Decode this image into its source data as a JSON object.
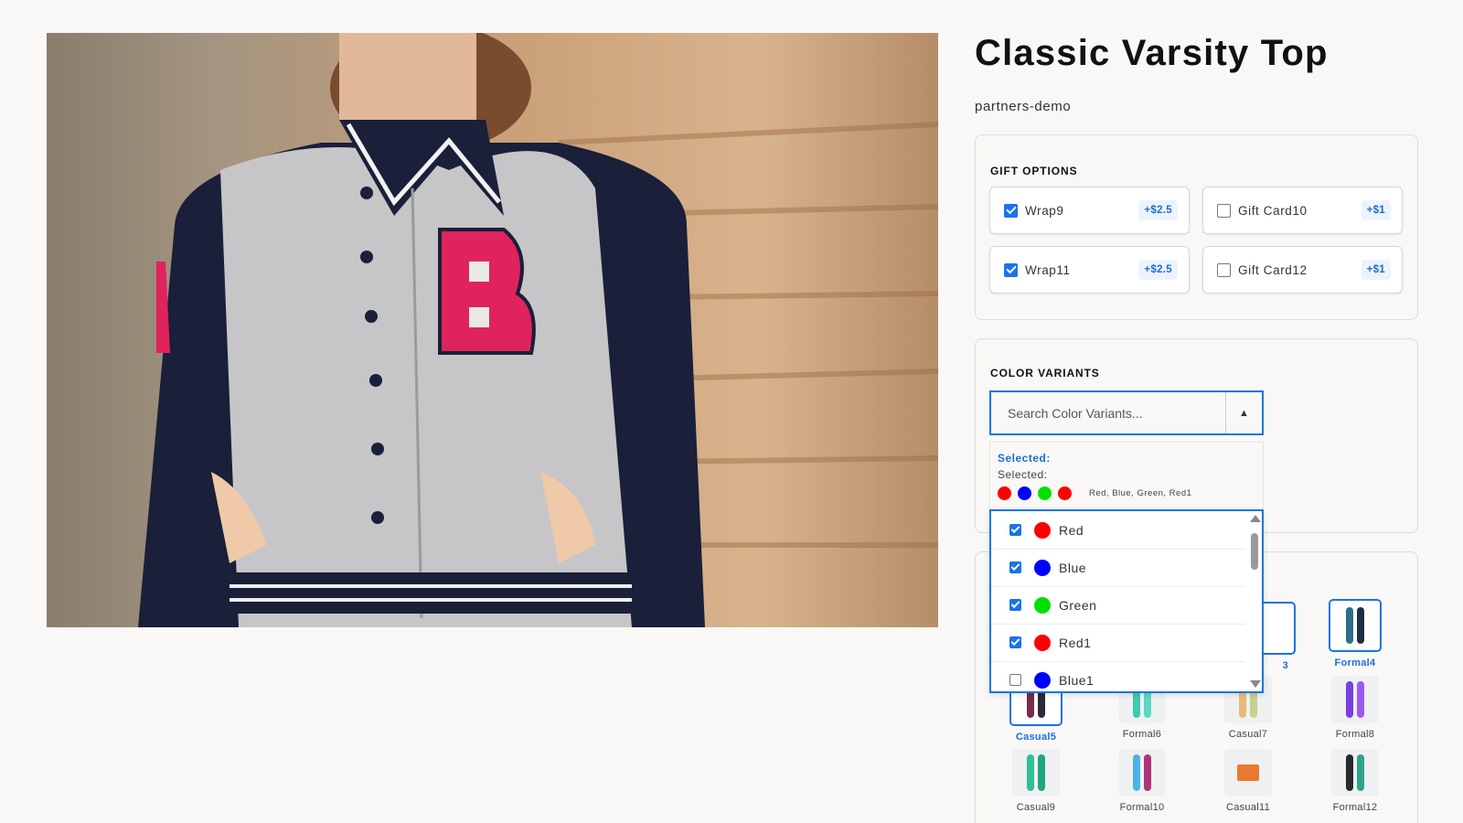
{
  "product": {
    "title": "Classic Varsity Top",
    "vendor": "partners-demo",
    "image_alt": "Woman wearing a grey and navy varsity jacket with a pink B patch"
  },
  "gift_options": {
    "heading": "GIFT OPTIONS",
    "options": [
      {
        "label": "Wrap9",
        "price": "+$2.5",
        "checked": true
      },
      {
        "label": "Gift Card10",
        "price": "+$1",
        "checked": false
      },
      {
        "label": "Wrap11",
        "price": "+$2.5",
        "checked": true
      },
      {
        "label": "Gift Card12",
        "price": "+$1",
        "checked": false
      }
    ]
  },
  "color_variants": {
    "heading": "COLOR VARIANTS",
    "search_placeholder": "Search Color Variants...",
    "toggle_icon": "▲",
    "selected_heading": "Selected:",
    "selected_sub": "Selected:",
    "selected_colors": [
      "#ff0000",
      "#0000ff",
      "#00e000",
      "#ff0000"
    ],
    "selected_names": "Red, Blue, Green, Red1",
    "options": [
      {
        "name": "Red",
        "color": "#ff0000",
        "checked": true
      },
      {
        "name": "Blue",
        "color": "#0000ff",
        "checked": true
      },
      {
        "name": "Green",
        "color": "#00e000",
        "checked": true
      },
      {
        "name": "Red1",
        "color": "#ff0000",
        "checked": true
      },
      {
        "name": "Blue1",
        "color": "#0000ff",
        "checked": false
      }
    ]
  },
  "styles": {
    "items": [
      {
        "label": "3",
        "selected": true
      },
      {
        "label": "Formal4",
        "selected": true
      },
      {
        "label": "Casual5",
        "selected": true
      },
      {
        "label": "Formal6",
        "selected": false
      },
      {
        "label": "Casual7",
        "selected": false
      },
      {
        "label": "Formal8",
        "selected": false
      },
      {
        "label": "Casual9",
        "selected": false
      },
      {
        "label": "Formal10",
        "selected": false
      },
      {
        "label": "Casual11",
        "selected": false
      },
      {
        "label": "Formal12",
        "selected": false
      }
    ]
  },
  "colors": {
    "accent": "#1a73e8",
    "price_text": "#1a6fd8"
  }
}
